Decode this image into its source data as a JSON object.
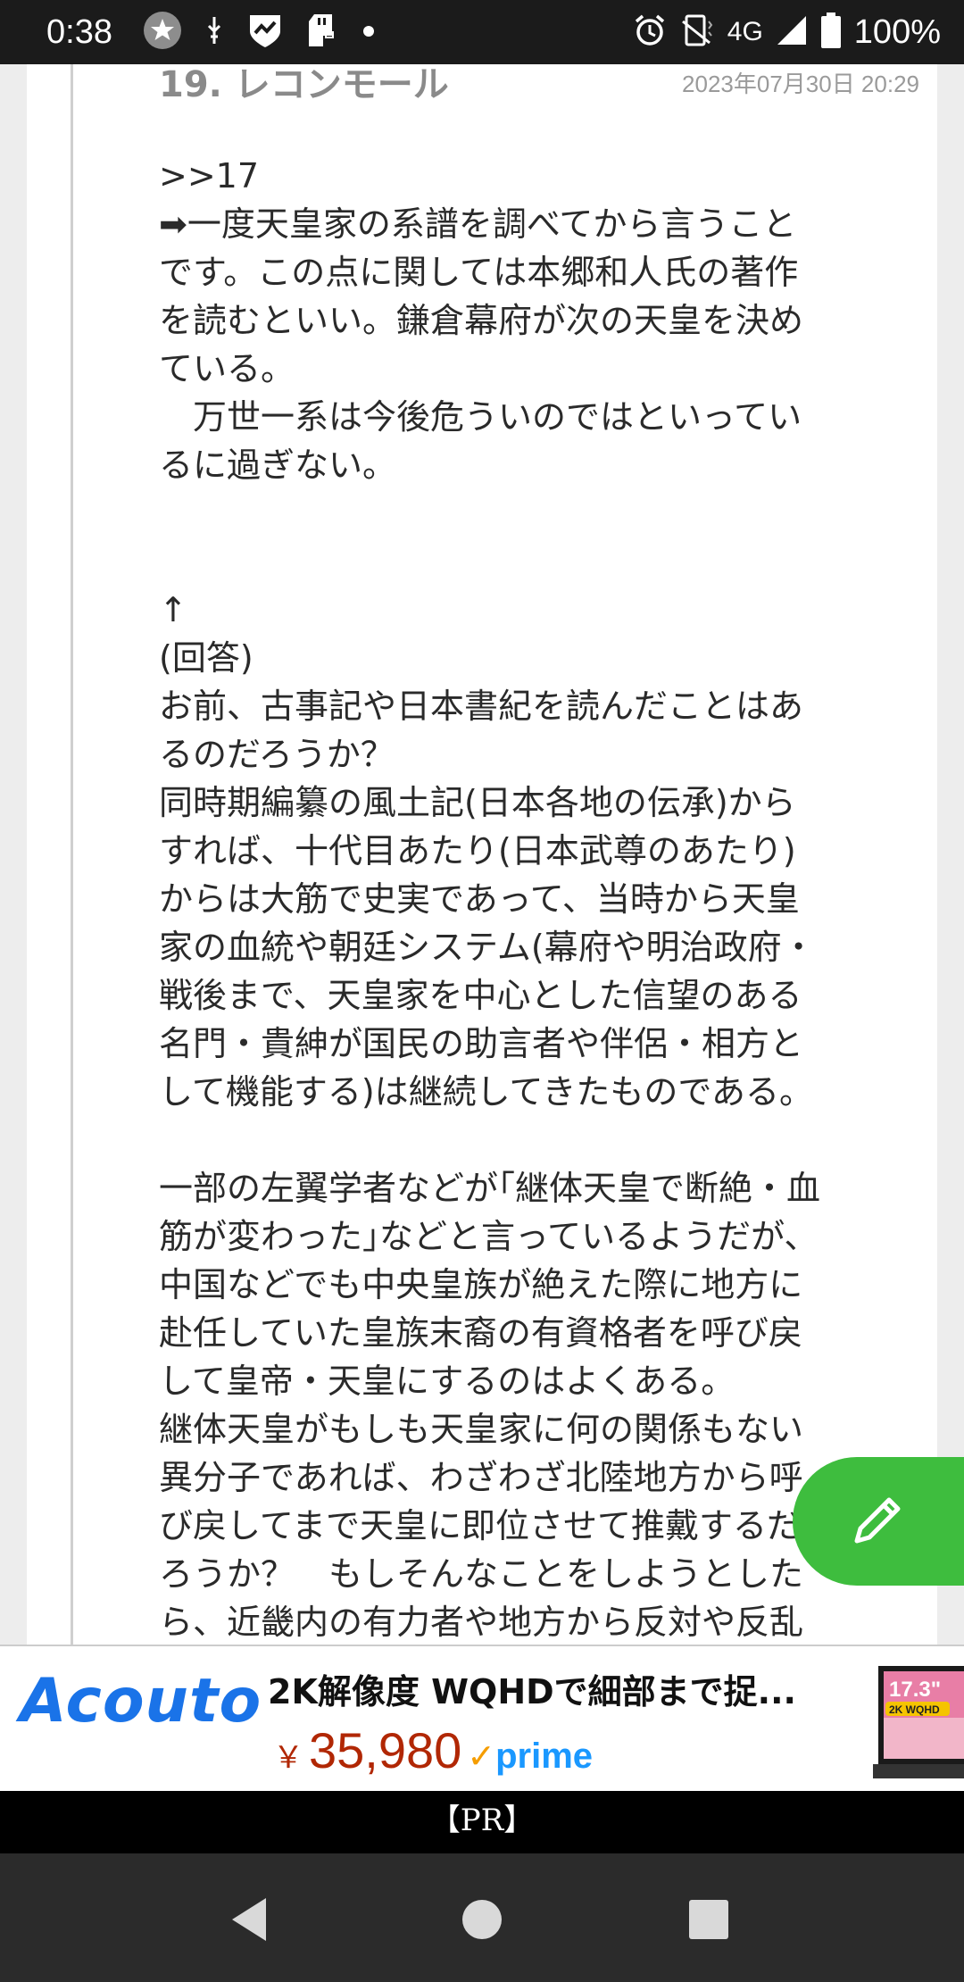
{
  "status_bar": {
    "time": "0:38",
    "network": "4G",
    "battery": "100%",
    "left_icons": [
      "star-icon",
      "usb-icon",
      "shield-icon",
      "sdcard-icon",
      "dot-icon"
    ],
    "right_icons": [
      "alarm-icon",
      "vibrate-icon",
      "signal-icon",
      "battery-icon"
    ]
  },
  "post": {
    "number": "19.",
    "author": "レコンモール",
    "date": "2023年07月30日 20:29",
    "lines": [
      ">>17",
      "➡一度天皇家の系譜を調べてから言うこと",
      "です。この点に関しては本郷和人氏の著作",
      "を読むといい。鎌倉幕府が次の天皇を決め",
      "ている。",
      "　万世一系は今後危ういのではといってい",
      "るに過ぎない。",
      "",
      "",
      "↑",
      "(回答)",
      "お前、古事記や日本書紀を読んだことはあ",
      "るのだろうか？",
      "同時期編纂の風土記(日本各地の伝承)から",
      "すれば、十代目あたり(日本武尊のあたり)",
      "からは大筋で史実であって、当時から天皇",
      "家の血統や朝廷システム(幕府や明治政府・",
      "戦後まで、天皇家を中心とした信望のある",
      "名門・貴紳が国民の助言者や伴侶・相方と",
      "して機能する)は継続してきたものである。",
      "",
      "一部の左翼学者などが｢継体天皇で断絶・血",
      "筋が変わった｣などと言っているようだが、",
      "中国などでも中央皇族が絶えた際に地方に",
      "赴任していた皇族末裔の有資格者を呼び戻",
      "して皇帝・天皇にするのはよくある。",
      "継体天皇がもしも天皇家に何の関係もない",
      "異分子であれば、わざわざ北陸地方から呼",
      "び戻してまで天皇に即位させて推戴するだ",
      "ろうか？　もしそんなことをしようとした",
      "ら、近畿内の有力者や地方から反対や反乱"
    ]
  },
  "ad": {
    "brand": "Acouto",
    "title": "2K解像度 WQHDで細部まで捉...",
    "currency": "￥",
    "price": "35,980",
    "prime": "prime",
    "image_badge": "17.3\"",
    "image_sub": "2K WQHD"
  },
  "pr_label": "【PR】",
  "colors": {
    "fab": "#3ebd3e",
    "brand": "#1a73e8",
    "price": "#b12704",
    "prime": "#1a98ff"
  }
}
